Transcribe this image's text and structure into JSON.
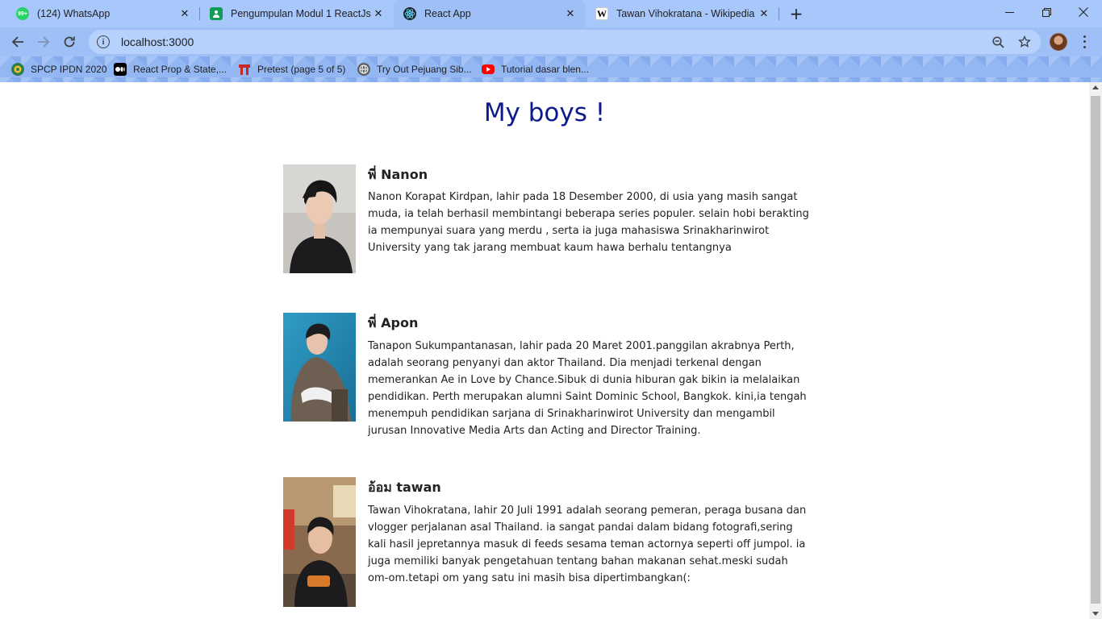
{
  "browser": {
    "tabs": [
      {
        "label": "(124) WhatsApp",
        "icon": "whatsapp-icon",
        "icon_text": "99+",
        "icon_color": "#25d366",
        "active": false
      },
      {
        "label": "Pengumpulan Modul 1 ReactJs",
        "icon": "google-classroom-icon",
        "icon_text": "",
        "icon_color": "#0f9d58",
        "active": false
      },
      {
        "label": "React App",
        "icon": "react-icon",
        "icon_text": "",
        "icon_color": "#20232a",
        "active": true
      },
      {
        "label": "Tawan Vihokratana - Wikipedia b",
        "icon": "wikipedia-icon",
        "icon_text": "W",
        "icon_color": "#ffffff",
        "active": false
      }
    ],
    "new_tab_label": "+",
    "address": "localhost:3000",
    "bookmarks": [
      {
        "label": "SPCP IPDN 2020",
        "icon": "ipdn-icon",
        "color": "#2f7d4f"
      },
      {
        "label": "React Prop & State,...",
        "icon": "medium-icon",
        "color": "#000000"
      },
      {
        "label": "Pretest (page 5 of 5)",
        "icon": "pretest-icon",
        "color": "#c62828"
      },
      {
        "label": "Try Out Pejuang Sib...",
        "icon": "globe-icon",
        "color": "#5f6368"
      },
      {
        "label": "Tutorial dasar blen...",
        "icon": "youtube-icon",
        "color": "#ff0000"
      }
    ]
  },
  "page": {
    "title": "My boys !",
    "profiles": [
      {
        "name": "พี่ Nanon",
        "description": "Nanon Korapat Kirdpan, lahir pada 18 Desember 2000, di usia yang masih sangat muda, ia telah berhasil membintangi beberapa series populer. selain hobi berakting ia mempunyai suara yang merdu , serta ia juga mahasiswa Srinakharinwirot University yang tak jarang membuat kaum hawa berhalu tentangnya"
      },
      {
        "name": "พี่ Apon",
        "description": "Tanapon Sukumpantanasan, lahir pada 20 Maret 2001.panggilan akrabnya Perth, adalah seorang penyanyi dan aktor Thailand. Dia menjadi terkenal dengan memerankan Ae in Love by Chance.Sibuk di dunia hiburan gak bikin ia melalaikan pendidikan. Perth merupakan alumni Saint Dominic School, Bangkok. kini,ia tengah menempuh pendidikan sarjana di Srinakharinwirot University dan mengambil jurusan Innovative Media Arts dan Acting and Director Training."
      },
      {
        "name": "อ้อม tawan",
        "description": "Tawan Vihokratana, lahir 20 Juli 1991 adalah seorang pemeran, peraga busana dan vlogger perjalanan asal Thailand. ia sangat pandai dalam bidang fotografi,sering kali hasil jepretannya masuk di feeds sesama teman actornya seperti off jumpol. ia juga memiliki banyak pengetahuan tentang bahan makanan sehat.meski sudah om-om.tetapi om yang satu ini masih bisa dipertimbangkan(:"
      }
    ]
  }
}
